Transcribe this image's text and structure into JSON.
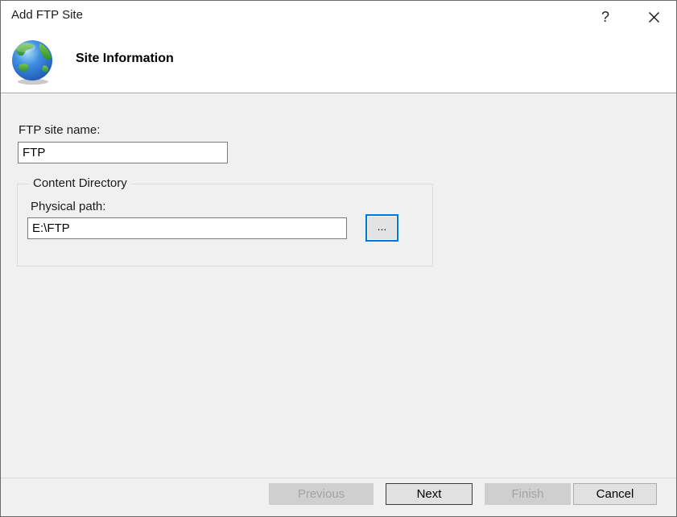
{
  "window": {
    "title": "Add FTP Site"
  },
  "titlebar": {
    "help_glyph": "?"
  },
  "header": {
    "title": "Site Information"
  },
  "form": {
    "site_name_label": "FTP site name:",
    "site_name_value": "FTP",
    "group_label": "Content Directory",
    "physical_path_label": "Physical path:",
    "physical_path_value": "E:\\FTP",
    "browse_label": "..."
  },
  "footer": {
    "previous_label": "Previous",
    "next_label": "Next",
    "finish_label": "Finish",
    "cancel_label": "Cancel"
  },
  "colors": {
    "accent": "#0078d7",
    "window_border": "#6b6b6b",
    "header_bg": "#ffffff",
    "body_bg": "#f0f0f0",
    "header_divider": "#a3a3a3",
    "input_border": "#7b7b7b",
    "button_bg": "#e1e1e1",
    "button_border": "#adadad",
    "default_button_border": "#3c3c3c",
    "disabled_button_bg": "#cfcfcf",
    "disabled_button_text": "#a3a3a3"
  }
}
